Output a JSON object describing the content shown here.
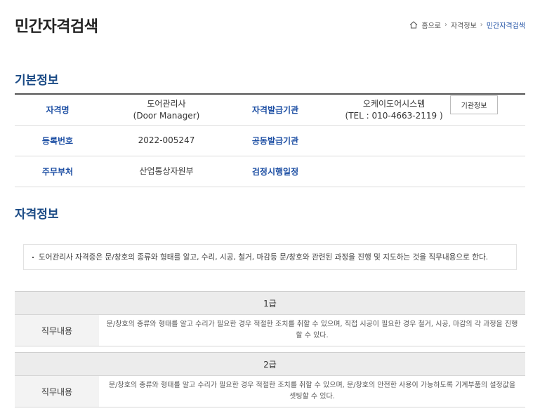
{
  "page": {
    "title": "민간자격검색"
  },
  "breadcrumb": {
    "home": "홈으로",
    "level1": "자격정보",
    "current": "민간자격검색"
  },
  "sections": {
    "basic": "기본정보",
    "qualification": "자격정보"
  },
  "basic_info": {
    "row1": {
      "label": "자격명",
      "value_line1": "도어관리사",
      "value_line2": "(Door Manager)",
      "label2": "자격발급기관",
      "value2_line1": "오케이도어시스템",
      "value2_line2": "(TEL : 010-4663-2119 )",
      "button": "기관정보"
    },
    "row2": {
      "label": "등록번호",
      "value": "2022-005247",
      "label2": "공동발급기관",
      "value2": ""
    },
    "row3": {
      "label": "주무부처",
      "value": "산업통상자원부",
      "label2": "검정시행일정",
      "value2": ""
    }
  },
  "summary": "도어관리사 자격증은 문/창호의 종류와 형태를 알고, 수리, 시공, 철거, 마감등 문/창호와 관련된 과정을 진행 및 지도하는 것을 직무내용으로 한다.",
  "grades": [
    {
      "name": "1급",
      "label": "직무내용",
      "desc_line1": "문/창호의 종류와 형태를 알고 수리가 필요한 경우 적절한 조치를 취할 수 있으며, 직접 시공이 필요한 경우 철거, 시공, 마감의 각 과정을 진행",
      "desc_line2": "할 수 있다."
    },
    {
      "name": "2급",
      "label": "직무내용",
      "desc_line1": "문/창호의 종류와 형태를 알고 수리가 필요한 경우 적절한 조치를 취할 수 있으며, 문/창호의 안전한 사용이 가능하도록 기계부품의 설정값을",
      "desc_line2": "셋팅할 수 있다."
    }
  ]
}
